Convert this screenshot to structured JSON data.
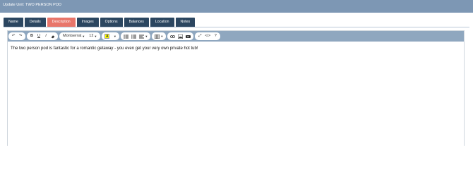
{
  "header": {
    "title": "Update Unit: TWO PERSON POD"
  },
  "tabs": [
    {
      "label": "Name"
    },
    {
      "label": "Details"
    },
    {
      "label": "Description",
      "active": true
    },
    {
      "label": "Images"
    },
    {
      "label": "Options"
    },
    {
      "label": "Balances"
    },
    {
      "label": "Location"
    },
    {
      "label": "Notes"
    }
  ],
  "toolbar": {
    "font_family": "Montserrat",
    "font_size": "12",
    "color_letter": "A",
    "help": "?"
  },
  "editor": {
    "content": "The two person pod is fantastic for a romantic getaway - you even get your very own private hot tub!"
  },
  "colors": {
    "header": "#7d97b4",
    "tab": "#2b4660",
    "tab_active": "#e8756a",
    "toolbar": "#8fa7bf"
  }
}
